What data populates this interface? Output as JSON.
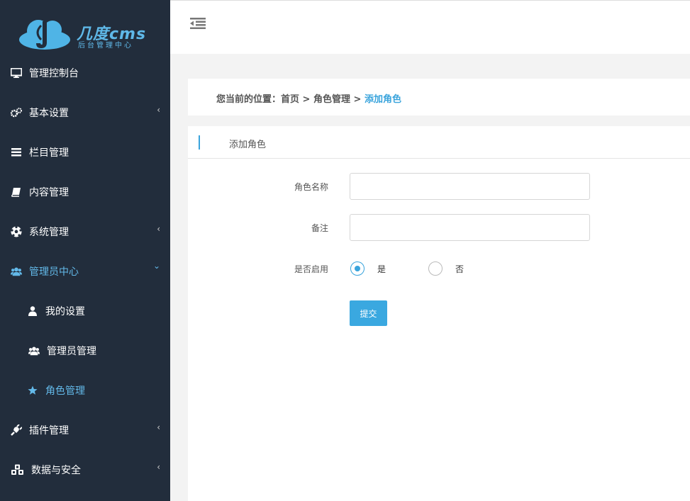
{
  "logo": {
    "brand": "几度cms",
    "subtitle": "后台管理中心"
  },
  "sidebar": {
    "items": [
      {
        "label": "管理控制台",
        "icon": "monitor-icon"
      },
      {
        "label": "基本设置",
        "icon": "gears-icon"
      },
      {
        "label": "栏目管理",
        "icon": "bars-icon"
      },
      {
        "label": "内容管理",
        "icon": "book-icon"
      },
      {
        "label": "系统管理",
        "icon": "soccer-ball-icon"
      },
      {
        "label": "管理员中心",
        "icon": "users-icon"
      },
      {
        "label": "我的设置",
        "icon": "user-icon"
      },
      {
        "label": "管理员管理",
        "icon": "users-icon"
      },
      {
        "label": "角色管理",
        "icon": "star-icon"
      },
      {
        "label": "插件管理",
        "icon": "plug-icon"
      },
      {
        "label": "数据与安全",
        "icon": "cubes-icon"
      }
    ],
    "arrow_left": "‹",
    "arrow_down": "⌄"
  },
  "breadcrumb": {
    "prefix": "您当前的位置：",
    "home": "首页",
    "sep1": " > ",
    "section": "角色管理",
    "sep2": " > ",
    "current": "添加角色"
  },
  "form": {
    "card_title": "添加角色",
    "role_name_label": "角色名称",
    "role_name_value": "",
    "remark_label": "备注",
    "remark_value": "",
    "enabled_label": "是否启用",
    "yes_label": "是",
    "no_label": "否",
    "submit_label": "提交"
  },
  "colors": {
    "sidebar_bg": "#222d3c",
    "accent": "#3aa4dc"
  }
}
